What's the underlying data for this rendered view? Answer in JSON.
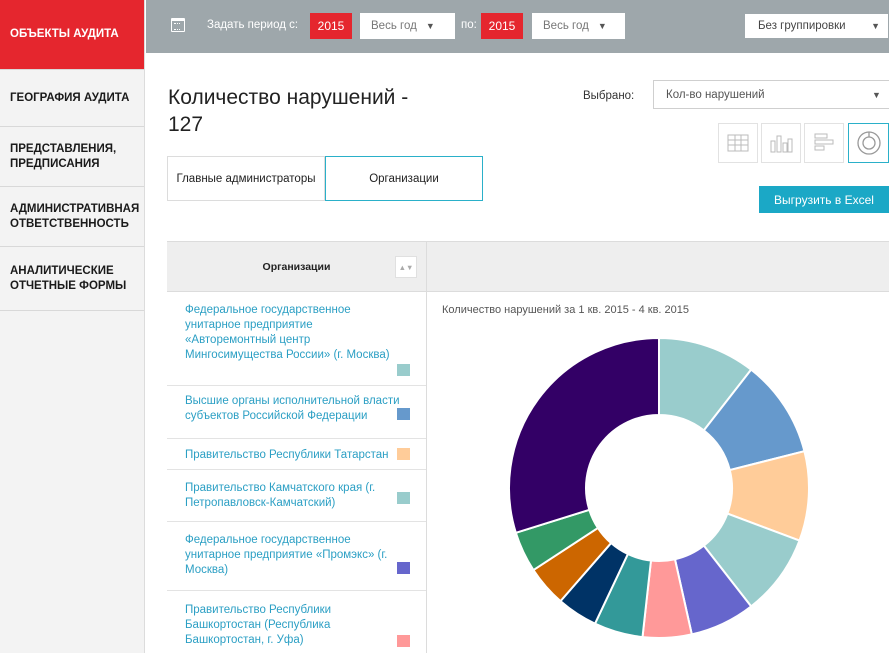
{
  "sidebar": {
    "items": [
      {
        "label": "ОБЪЕКТЫ АУДИТА",
        "active": true
      },
      {
        "label": "ГЕОГРАФИЯ АУДИТА"
      },
      {
        "label": "ПРЕДСТАВЛЕНИЯ, ПРЕДПИСАНИЯ"
      },
      {
        "label": "АДМИНИСТРАТИВНАЯ ОТВЕТСТВЕННОСТЬ"
      },
      {
        "label": "АНАЛИТИЧЕСКИЕ ОТЧЕТНЫЕ ФОРМЫ"
      }
    ]
  },
  "topbar": {
    "calendar_icon": "calendar-icon",
    "period_from_label": "Задать период с:",
    "from_year": "2015",
    "from_period": "Весь год",
    "to_label": "по:",
    "to_year": "2015",
    "to_period": "Весь год",
    "grouping": "Без группировки"
  },
  "header": {
    "title": "Количество нарушений - 127",
    "selected_label": "Выбрано:",
    "metric": "Кол-во нарушений",
    "export_label": "Выгрузить в Excel",
    "views": [
      "table-view-icon",
      "bar-chart-icon",
      "horizontal-bar-icon",
      "donut-chart-icon"
    ]
  },
  "tabs": [
    {
      "label": "Главные администраторы"
    },
    {
      "label": "Организации",
      "active": true
    }
  ],
  "table": {
    "column_header": "Организации",
    "sort_label": "▲▼",
    "rows": [
      {
        "name": "Федеральное государственное унитарное предприятие «Авторемонтный центр Мингосимущества России» (г. Москва)",
        "color": "#99cccc"
      },
      {
        "name": "Высшие органы исполнительной власти субъектов Российской Федерации",
        "color": "#6699cc"
      },
      {
        "name": "Правительство Республики Татарстан",
        "color": "#ffcc99"
      },
      {
        "name": "Правительство Камчатского края (г. Петропавловск-Камчатский)",
        "color": "#99cccc"
      },
      {
        "name": "Федеральное государственное унитарное предприятие «Промэкс» (г. Москва)",
        "color": "#6666cc"
      },
      {
        "name": "Правительство Республики Башкортостан (Республика Башкортостан, г. Уфа)",
        "color": "#ff9999"
      }
    ]
  },
  "chart_data": {
    "type": "pie",
    "subtype": "donut",
    "title": "Количество нарушений за 1 кв. 2015 - 4 кв. 2015",
    "slices": [
      {
        "value": 12,
        "color": "#99cccc"
      },
      {
        "value": 12,
        "color": "#6699cc"
      },
      {
        "value": 11,
        "color": "#ffcc99"
      },
      {
        "value": 10,
        "color": "#99cccc"
      },
      {
        "value": 8,
        "color": "#6666cc"
      },
      {
        "value": 6,
        "color": "#ff9999"
      },
      {
        "value": 6,
        "color": "#339999"
      },
      {
        "value": 5,
        "color": "#003366"
      },
      {
        "value": 5,
        "color": "#cc6600"
      },
      {
        "value": 5,
        "color": "#339966"
      },
      {
        "value": 34,
        "color": "#330066"
      }
    ]
  }
}
